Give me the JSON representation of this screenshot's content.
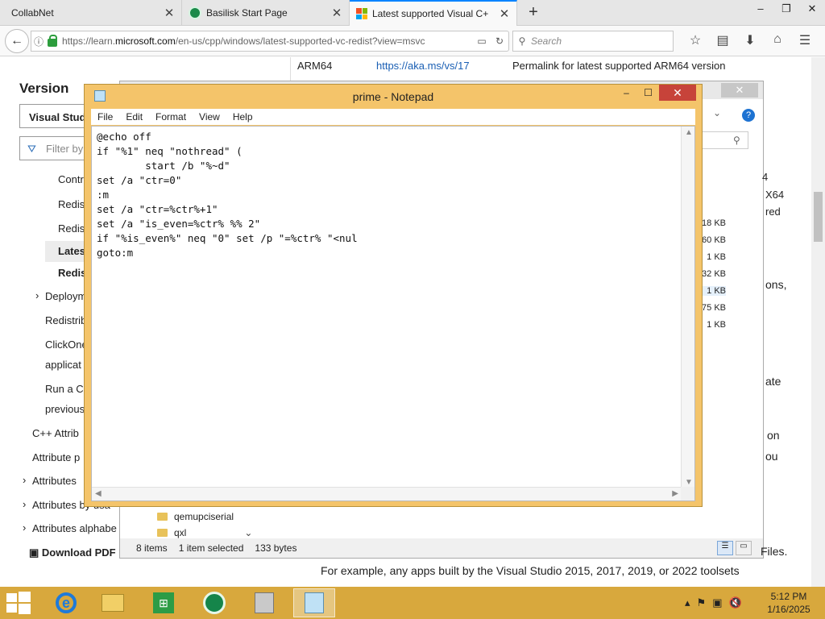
{
  "browser": {
    "tabs": [
      {
        "title": "CollabNet"
      },
      {
        "title": "Basilisk Start Page"
      },
      {
        "title": "Latest supported Visual C+"
      }
    ],
    "url_prefix": "https://learn.",
    "url_domain": "microsoft.com",
    "url_suffix": "/en-us/cpp/windows/latest-supported-vc-redist?view=msvc",
    "search_placeholder": "Search"
  },
  "page": {
    "arm_label": "ARM64",
    "arm_link": "https://aka.ms/vs/17",
    "arm_desc": "Permalink for latest supported ARM64 version",
    "version_heading": "Version",
    "version_select": "Visual Studi",
    "filter_placeholder": "Filter by",
    "toc": [
      "Contri",
      "Redis",
      "Redis",
      "Lates",
      "Redis",
      "Deploym",
      "Redistrib",
      "ClickOne",
      "applicat",
      "Run a C",
      "previous",
      "C++ Attrib",
      "Attribute p",
      "Attributes",
      "Attributes by usa",
      "Attributes alphabe"
    ],
    "download_pdf": "Download PDF",
    "sizes": [
      "18 KB",
      "60 KB",
      "1 KB",
      "32 KB",
      "1 KB",
      "75 KB",
      "1 KB"
    ],
    "right_snippets": [
      "4",
      "X64",
      "red",
      "ons,",
      "ate",
      "on",
      "ou",
      "Files."
    ],
    "example_text": "For example, any apps built by the Visual Studio 2015, 2017, 2019, or 2022 toolsets"
  },
  "explorer": {
    "tree": [
      "qemupciserial",
      "qxl"
    ],
    "status_items": "8 items",
    "status_selected": "1 item selected",
    "status_size": "133 bytes"
  },
  "notepad": {
    "title": "prime - Notepad",
    "menu": [
      "File",
      "Edit",
      "Format",
      "View",
      "Help"
    ],
    "content": "@echo off\nif \"%1\" neq \"nothread\" (\n        start /b \"%~d\"\nset /a \"ctr=0\"\n:m\nset /a \"ctr=%ctr%+1\"\nset /a \"is_even=%ctr% %% 2\"\nif \"%is_even%\" neq \"0\" set /p \"=%ctr% \"<nul\ngoto:m"
  },
  "taskbar": {
    "time": "5:12 PM",
    "date": "1/16/2025"
  },
  "colors": {
    "taskbar": "#d8a83d",
    "notepad_frame": "#f4c46a",
    "close_red": "#c7433a",
    "link_blue": "#1a5fb4"
  }
}
